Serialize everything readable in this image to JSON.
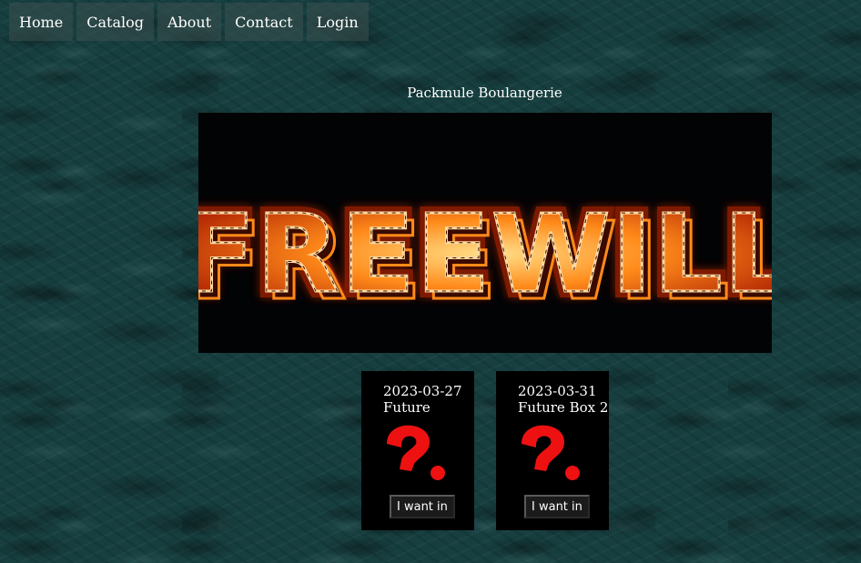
{
  "nav": {
    "items": [
      {
        "label": "Home"
      },
      {
        "label": "Catalog"
      },
      {
        "label": "About"
      },
      {
        "label": "Contact"
      },
      {
        "label": "Login"
      }
    ]
  },
  "site": {
    "title": "Packmule Boulangerie",
    "banner_text": "FREEWILL"
  },
  "cards": [
    {
      "date": "2023-03-27",
      "name": "Future",
      "button_label": "I want in",
      "icon": "question-mark-icon"
    },
    {
      "date": "2023-03-31",
      "name": "Future Box 2",
      "button_label": "I want in",
      "icon": "question-mark-icon"
    }
  ],
  "colors": {
    "background": "#173f40",
    "banner_bg": "#020304",
    "fire_orange": "#ff7a1a",
    "icon_red": "#ee1111"
  }
}
